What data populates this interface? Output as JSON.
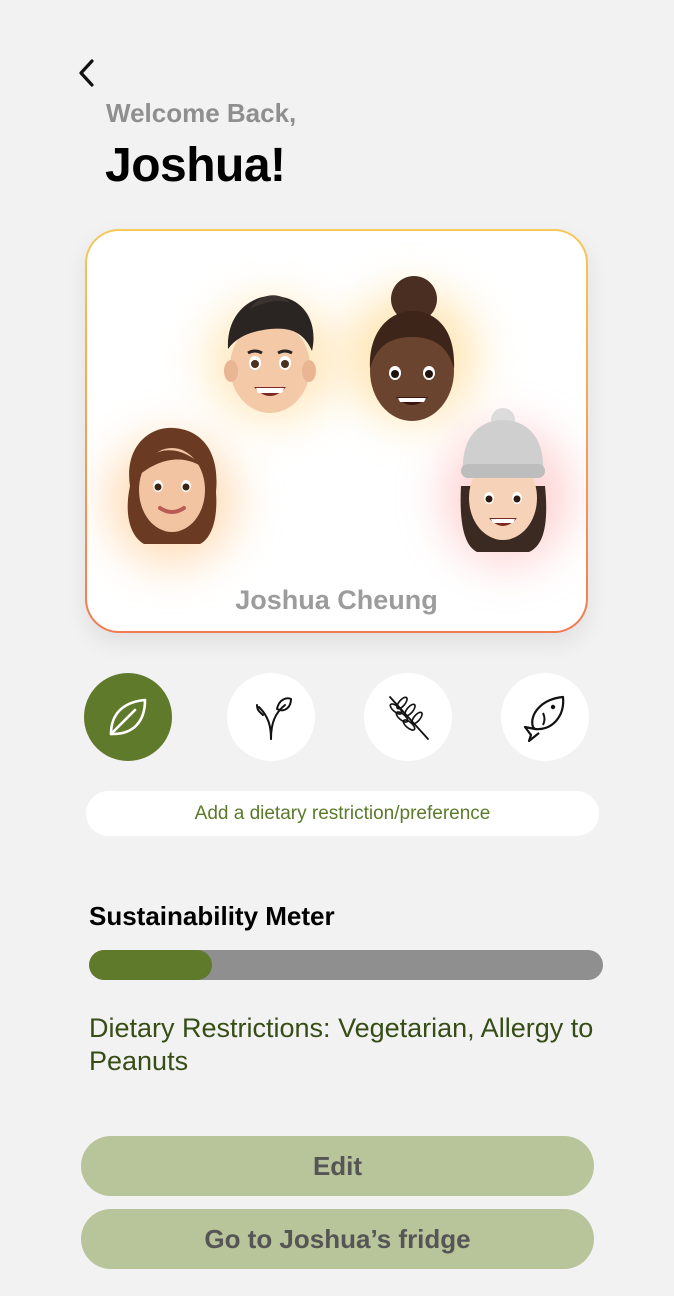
{
  "header": {
    "back_icon": "chevron-left-icon",
    "welcome_text": "Welcome Back,",
    "user_name": "Joshua!"
  },
  "profile_card": {
    "display_name": "Joshua Cheung",
    "border_colors": [
      "#f7c85a",
      "#f27a52"
    ]
  },
  "diet_options": [
    {
      "icon": "leaf-icon",
      "selected": true
    },
    {
      "icon": "sprout-icon",
      "selected": false
    },
    {
      "icon": "wheat-icon",
      "selected": false
    },
    {
      "icon": "fish-icon",
      "selected": false
    }
  ],
  "add_preference_label": "Add a dietary restriction/preference",
  "sustainability": {
    "title": "Sustainability Meter",
    "progress_fraction": 0.24
  },
  "restrictions_text": "Dietary Restrictions: Vegetarian, Allergy to Peanuts",
  "buttons": {
    "edit_label": "Edit",
    "fridge_label": "Go to Joshua’s fridge"
  },
  "colors": {
    "accent_green": "#5f7a2b",
    "button_green": "#b8c49a",
    "background": "#f2f2f2"
  }
}
